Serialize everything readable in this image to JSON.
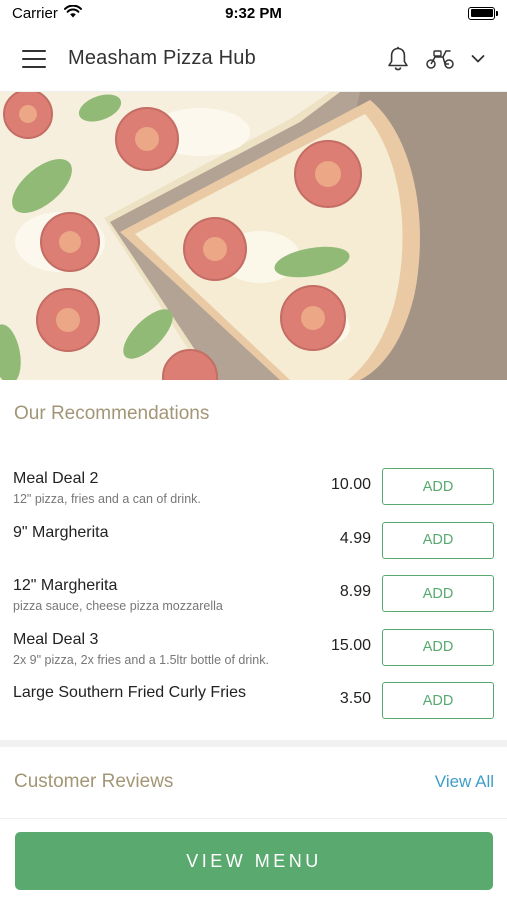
{
  "status_bar": {
    "carrier": "Carrier",
    "time": "9:32 PM"
  },
  "header": {
    "title": "Measham Pizza Hub",
    "icons": [
      "menu-icon",
      "bell-icon",
      "scooter-icon",
      "chevron-down-icon"
    ]
  },
  "hero": {
    "image": "pizza-hero-image"
  },
  "recommendations": {
    "title": "Our Recommendations",
    "items": [
      {
        "name": "Meal Deal 2",
        "description": "12\" pizza, fries and a can of drink.",
        "price": "10.00",
        "button": "ADD"
      },
      {
        "name": "9\" Margherita",
        "description": "",
        "price": "4.99",
        "button": "ADD"
      },
      {
        "name": "12\" Margherita",
        "description": "pizza sauce, cheese pizza mozzarella",
        "price": "8.99",
        "button": "ADD"
      },
      {
        "name": "Meal Deal 3",
        "description": "2x 9\" pizza, 2x fries and a 1.5ltr bottle of drink.",
        "price": "15.00",
        "button": "ADD"
      },
      {
        "name": "Large Southern Fried Curly Fries",
        "description": "",
        "price": "3.50",
        "button": "ADD"
      }
    ]
  },
  "reviews": {
    "title": "Customer Reviews",
    "view_all": "View All"
  },
  "footer": {
    "view_menu": "VIEW MENU"
  },
  "colors": {
    "accent_green": "#5aa96e",
    "link_blue": "#3f9ec9",
    "section_title": "#a39676"
  }
}
